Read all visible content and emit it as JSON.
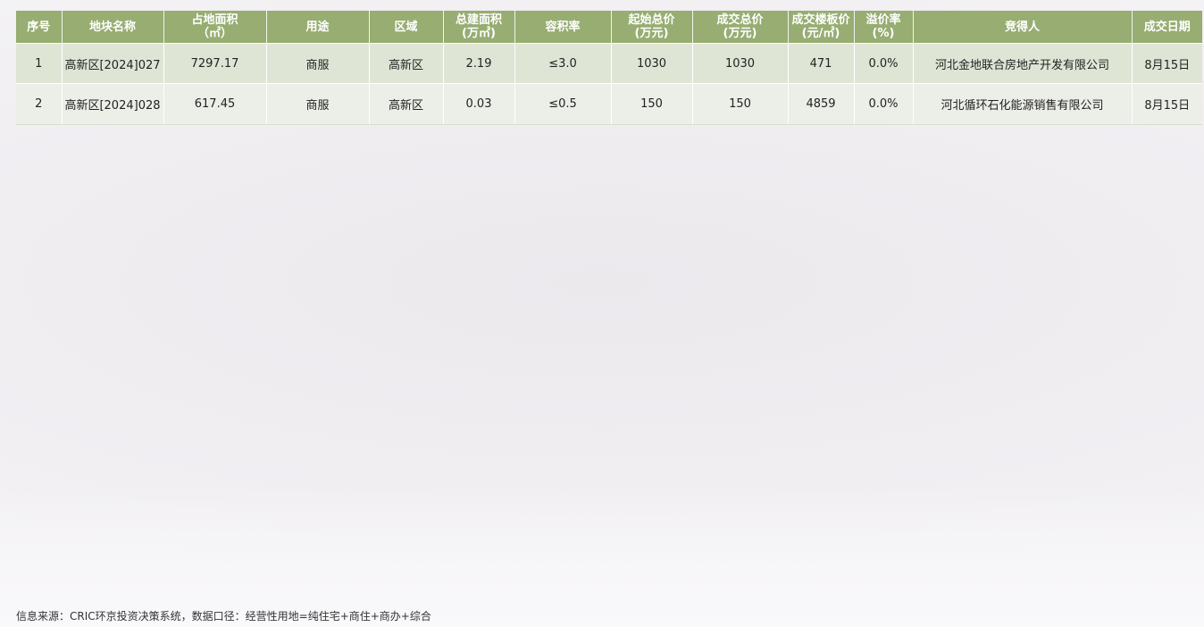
{
  "table": {
    "headers": [
      [
        "序号"
      ],
      [
        "地块名称"
      ],
      [
        "占地面积",
        "（㎡）"
      ],
      [
        "用途"
      ],
      [
        "区域"
      ],
      [
        "总建面积",
        "(万㎡)"
      ],
      [
        "容积率"
      ],
      [
        "起始总价",
        "(万元)"
      ],
      [
        "成交总价",
        "(万元)"
      ],
      [
        "成交楼板价",
        "(元/㎡)"
      ],
      [
        "溢价率",
        "(%)"
      ],
      [
        "竞得人"
      ],
      [
        "成交日期"
      ]
    ],
    "rows": [
      [
        "1",
        "高新区[2024]027",
        "7297.17",
        "商服",
        "高新区",
        "2.19",
        "≤3.0",
        "1030",
        "1030",
        "471",
        "0.0%",
        "河北金地联合房地产开发有限公司",
        "8月15日"
      ],
      [
        "2",
        "高新区[2024]028",
        "617.45",
        "商服",
        "高新区",
        "0.03",
        "≤0.5",
        "150",
        "150",
        "4859",
        "0.0%",
        "河北循环石化能源销售有限公司",
        "8月15日"
      ]
    ]
  },
  "footer": {
    "source_note": "信息来源：CRIC环京投资决策系统，数据口径：经营性用地=纯住宅+商住+商办+综合"
  },
  "colors": {
    "header_bg": "#97ad72",
    "header_text": "#ffffff",
    "row_odd_bg": "#dfe5d5",
    "row_even_bg": "#eceee8"
  }
}
